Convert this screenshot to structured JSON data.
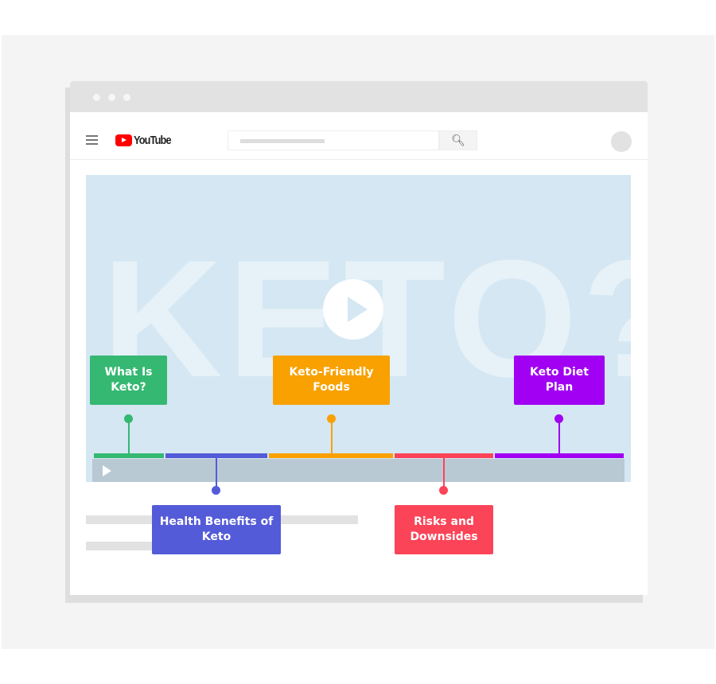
{
  "browser": {
    "window_dots": 3
  },
  "header": {
    "logo_text": "YouTube",
    "search_icon": "search-icon",
    "menu_icon": "hamburger-icon"
  },
  "video": {
    "background_text": "KETO?",
    "chapters": [
      {
        "title": "What Is Keto?",
        "color": "#35b872"
      },
      {
        "title": "Health Benefits of Keto",
        "color": "#545bd8"
      },
      {
        "title": "Keto-Friendly Foods",
        "color": "#f8a100"
      },
      {
        "title": "Risks and Downsides",
        "color": "#fb4458"
      },
      {
        "title": "Keto Diet Plan",
        "color": "#a100f2"
      }
    ]
  }
}
